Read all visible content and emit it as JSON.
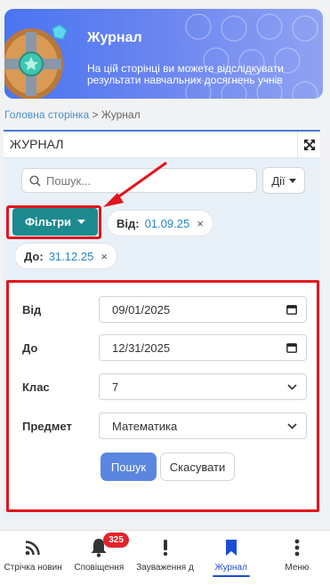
{
  "banner": {
    "title": "Журнал",
    "text": "На цій сторінці ви можете відслідкувати результати навчальних досягнень учнів"
  },
  "breadcrumb": {
    "home": "Головна сторінка",
    "separator": " > ",
    "current": "Журнал"
  },
  "panel": {
    "title": "ЖУРНАЛ",
    "expand_icon": "expand-arrows-icon"
  },
  "search": {
    "placeholder": "Пошук...",
    "value": ""
  },
  "actions": {
    "label": "Дії"
  },
  "filters_button": {
    "label": "Фільтри"
  },
  "chips": [
    {
      "label": "Від:",
      "value": "01.09.25",
      "close": "×"
    },
    {
      "label": "До:",
      "value": "31.12.25",
      "close": "×"
    }
  ],
  "form": {
    "from": {
      "label": "Від",
      "value": "09/01/2025"
    },
    "to": {
      "label": "До",
      "value": "12/31/2025"
    },
    "class": {
      "label": "Клас",
      "value": "7"
    },
    "subject": {
      "label": "Предмет",
      "value": "Математика"
    },
    "submit_label": "Пошук",
    "cancel_label": "Скасувати"
  },
  "bottom_nav": [
    {
      "label": "Стрічка новин",
      "icon": "rss-icon",
      "active": false
    },
    {
      "label": "Сповіщення",
      "icon": "bell-icon",
      "active": false,
      "badge": "325"
    },
    {
      "label": "Зауваження д",
      "icon": "exclamation-icon",
      "active": false
    },
    {
      "label": "Журнал",
      "icon": "bookmark-icon",
      "active": true
    },
    {
      "label": "Меню",
      "icon": "kebab-menu-icon",
      "active": false
    }
  ],
  "colors": {
    "accent": "#4a7bd8",
    "filter_button": "#1c8a8e",
    "highlight": "#e2141c",
    "active_nav": "#1a4ed8",
    "badge": "#e3242b"
  }
}
